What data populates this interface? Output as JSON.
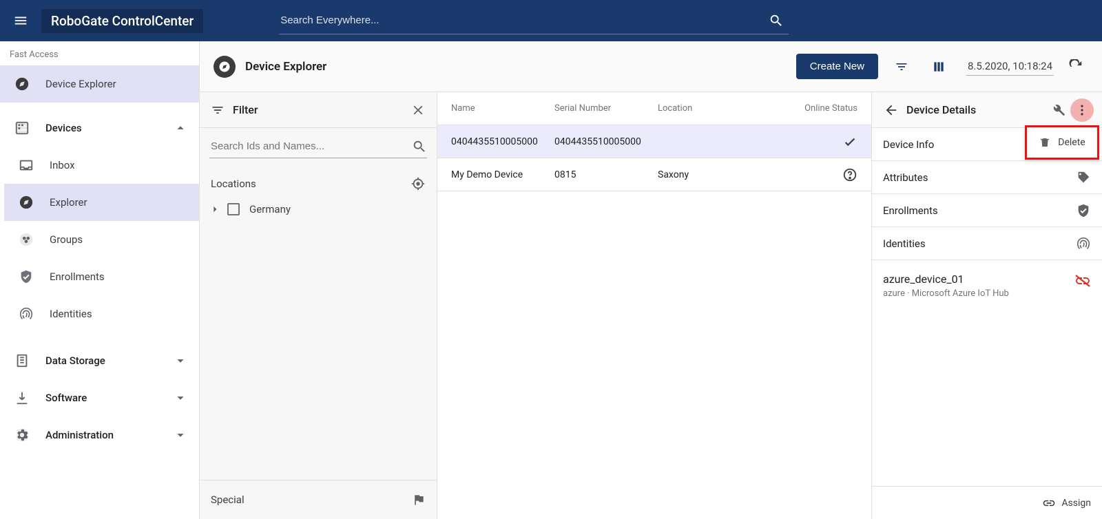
{
  "app_title": "RoboGate ControlCenter",
  "search_placeholder": "Search Everywhere...",
  "fast_access_label": "Fast Access",
  "fast_access_item": "Device Explorer",
  "sidebar": {
    "devices": "Devices",
    "inbox": "Inbox",
    "explorer": "Explorer",
    "groups": "Groups",
    "enrollments": "Enrollments",
    "identities": "Identities",
    "data_storage": "Data Storage",
    "software": "Software",
    "administration": "Administration"
  },
  "content_header": {
    "title": "Device Explorer",
    "create_new": "Create New",
    "timestamp": "8.5.2020, 10:18:24"
  },
  "filter": {
    "title": "Filter",
    "search_placeholder": "Search Ids and Names...",
    "locations_label": "Locations",
    "location_items": [
      "Germany"
    ],
    "special_label": "Special"
  },
  "table": {
    "headers": {
      "name": "Name",
      "serial": "Serial Number",
      "location": "Location",
      "status": "Online Status"
    },
    "rows": [
      {
        "name": "0404435510005000",
        "serial": "0404435510005000",
        "location": "",
        "status": "check",
        "selected": true
      },
      {
        "name": "My Demo Device",
        "serial": "0815",
        "location": "Saxony",
        "status": "help",
        "selected": false
      }
    ]
  },
  "details": {
    "title": "Device Details",
    "info": "Device Info",
    "attributes": "Attributes",
    "enrollments": "Enrollments",
    "identities": "Identities",
    "delete_label": "Delete",
    "identity_name": "azure_device_01",
    "identity_sub": "azure · Microsoft Azure IoT Hub",
    "assign": "Assign"
  }
}
